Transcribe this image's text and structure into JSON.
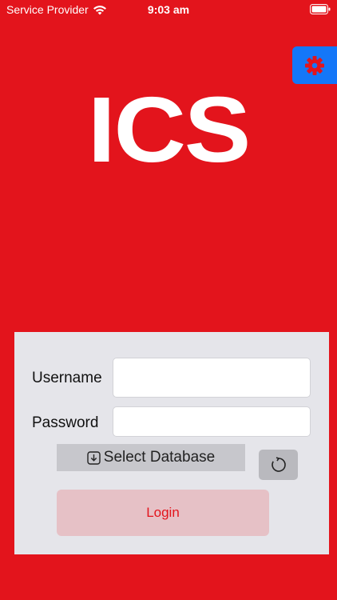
{
  "status_bar": {
    "carrier": "Service Provider",
    "time": "9:03 am",
    "icons": [
      "wifi-icon",
      "battery-icon"
    ]
  },
  "header": {
    "logo_text": "ICS",
    "settings_icon": "gear-icon"
  },
  "login_form": {
    "username_label": "Username",
    "username_value": "",
    "password_label": "Password",
    "password_value": "",
    "select_database_label": "Select Database",
    "select_database_icon": "download-icon",
    "refresh_icon": "refresh-icon",
    "login_label": "Login"
  },
  "colors": {
    "background": "#e3141c",
    "settings_button": "#1477f8",
    "card": "#e5e5ea",
    "select_button": "#c7c7cc",
    "login_button": "#e6c1c6",
    "login_text": "#e3141c"
  }
}
